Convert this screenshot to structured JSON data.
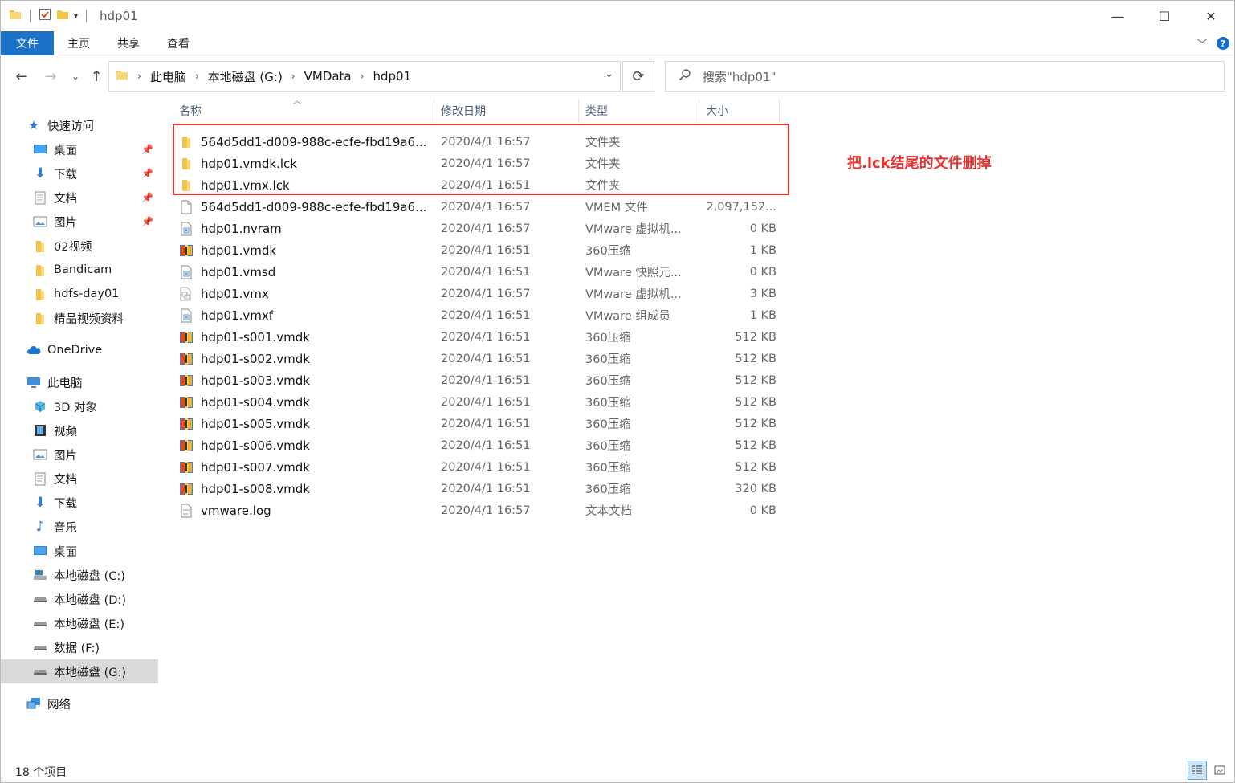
{
  "window": {
    "title": "hdp01"
  },
  "ribbon": {
    "tabs": [
      "文件",
      "主页",
      "共享",
      "查看"
    ]
  },
  "address": {
    "crumbs": [
      "此电脑",
      "本地磁盘 (G:)",
      "VMData",
      "hdp01"
    ]
  },
  "search": {
    "placeholder": "搜索\"hdp01\""
  },
  "sidebar": {
    "quick_access": "快速访问",
    "quick_items": [
      "桌面",
      "下载",
      "文档",
      "图片",
      "02视频",
      "Bandicam",
      "hdfs-day01",
      "精品视频资料"
    ],
    "onedrive": "OneDrive",
    "this_pc": "此电脑",
    "pc_items": [
      "3D 对象",
      "视频",
      "图片",
      "文档",
      "下载",
      "音乐",
      "桌面",
      "本地磁盘 (C:)",
      "本地磁盘 (D:)",
      "本地磁盘 (E:)",
      "数据 (F:)",
      "本地磁盘 (G:)"
    ],
    "network": "网络"
  },
  "columns": {
    "name": "名称",
    "date": "修改日期",
    "type": "类型",
    "size": "大小"
  },
  "files": [
    {
      "name": "564d5dd1-d009-988c-ecfe-fbd19a6...",
      "date": "2020/4/1 16:57",
      "type": "文件夹",
      "size": "",
      "icon": "folder-icon"
    },
    {
      "name": "hdp01.vmdk.lck",
      "date": "2020/4/1 16:57",
      "type": "文件夹",
      "size": "",
      "icon": "folder-icon"
    },
    {
      "name": "hdp01.vmx.lck",
      "date": "2020/4/1 16:51",
      "type": "文件夹",
      "size": "",
      "icon": "folder-icon"
    },
    {
      "name": "564d5dd1-d009-988c-ecfe-fbd19a6...",
      "date": "2020/4/1 16:57",
      "type": "VMEM 文件",
      "size": "2,097,152...",
      "icon": "blank-file-icon"
    },
    {
      "name": "hdp01.nvram",
      "date": "2020/4/1 16:57",
      "type": "VMware 虚拟机...",
      "size": "0 KB",
      "icon": "vmware-file-icon"
    },
    {
      "name": "hdp01.vmdk",
      "date": "2020/4/1 16:51",
      "type": "360压缩",
      "size": "1 KB",
      "icon": "archive-icon"
    },
    {
      "name": "hdp01.vmsd",
      "date": "2020/4/1 16:51",
      "type": "VMware 快照元...",
      "size": "0 KB",
      "icon": "vmware-file-icon"
    },
    {
      "name": "hdp01.vmx",
      "date": "2020/4/1 16:57",
      "type": "VMware 虚拟机...",
      "size": "3 KB",
      "icon": "vmware-vm-icon"
    },
    {
      "name": "hdp01.vmxf",
      "date": "2020/4/1 16:51",
      "type": "VMware 组成员",
      "size": "1 KB",
      "icon": "vmware-file-icon"
    },
    {
      "name": "hdp01-s001.vmdk",
      "date": "2020/4/1 16:51",
      "type": "360压缩",
      "size": "512 KB",
      "icon": "archive-icon"
    },
    {
      "name": "hdp01-s002.vmdk",
      "date": "2020/4/1 16:51",
      "type": "360压缩",
      "size": "512 KB",
      "icon": "archive-icon"
    },
    {
      "name": "hdp01-s003.vmdk",
      "date": "2020/4/1 16:51",
      "type": "360压缩",
      "size": "512 KB",
      "icon": "archive-icon"
    },
    {
      "name": "hdp01-s004.vmdk",
      "date": "2020/4/1 16:51",
      "type": "360压缩",
      "size": "512 KB",
      "icon": "archive-icon"
    },
    {
      "name": "hdp01-s005.vmdk",
      "date": "2020/4/1 16:51",
      "type": "360压缩",
      "size": "512 KB",
      "icon": "archive-icon"
    },
    {
      "name": "hdp01-s006.vmdk",
      "date": "2020/4/1 16:51",
      "type": "360压缩",
      "size": "512 KB",
      "icon": "archive-icon"
    },
    {
      "name": "hdp01-s007.vmdk",
      "date": "2020/4/1 16:51",
      "type": "360压缩",
      "size": "512 KB",
      "icon": "archive-icon"
    },
    {
      "name": "hdp01-s008.vmdk",
      "date": "2020/4/1 16:51",
      "type": "360压缩",
      "size": "320 KB",
      "icon": "archive-icon"
    },
    {
      "name": "vmware.log",
      "date": "2020/4/1 16:57",
      "type": "文本文档",
      "size": "0 KB",
      "icon": "text-file-icon"
    }
  ],
  "annotation": {
    "text": "把.lck结尾的文件删掉",
    "color": "#e8322f"
  },
  "status": {
    "count": "18 个项目"
  },
  "colors": {
    "accent": "#1a73c8",
    "folder": "#f3c44a",
    "highlight": "#e8322f"
  }
}
